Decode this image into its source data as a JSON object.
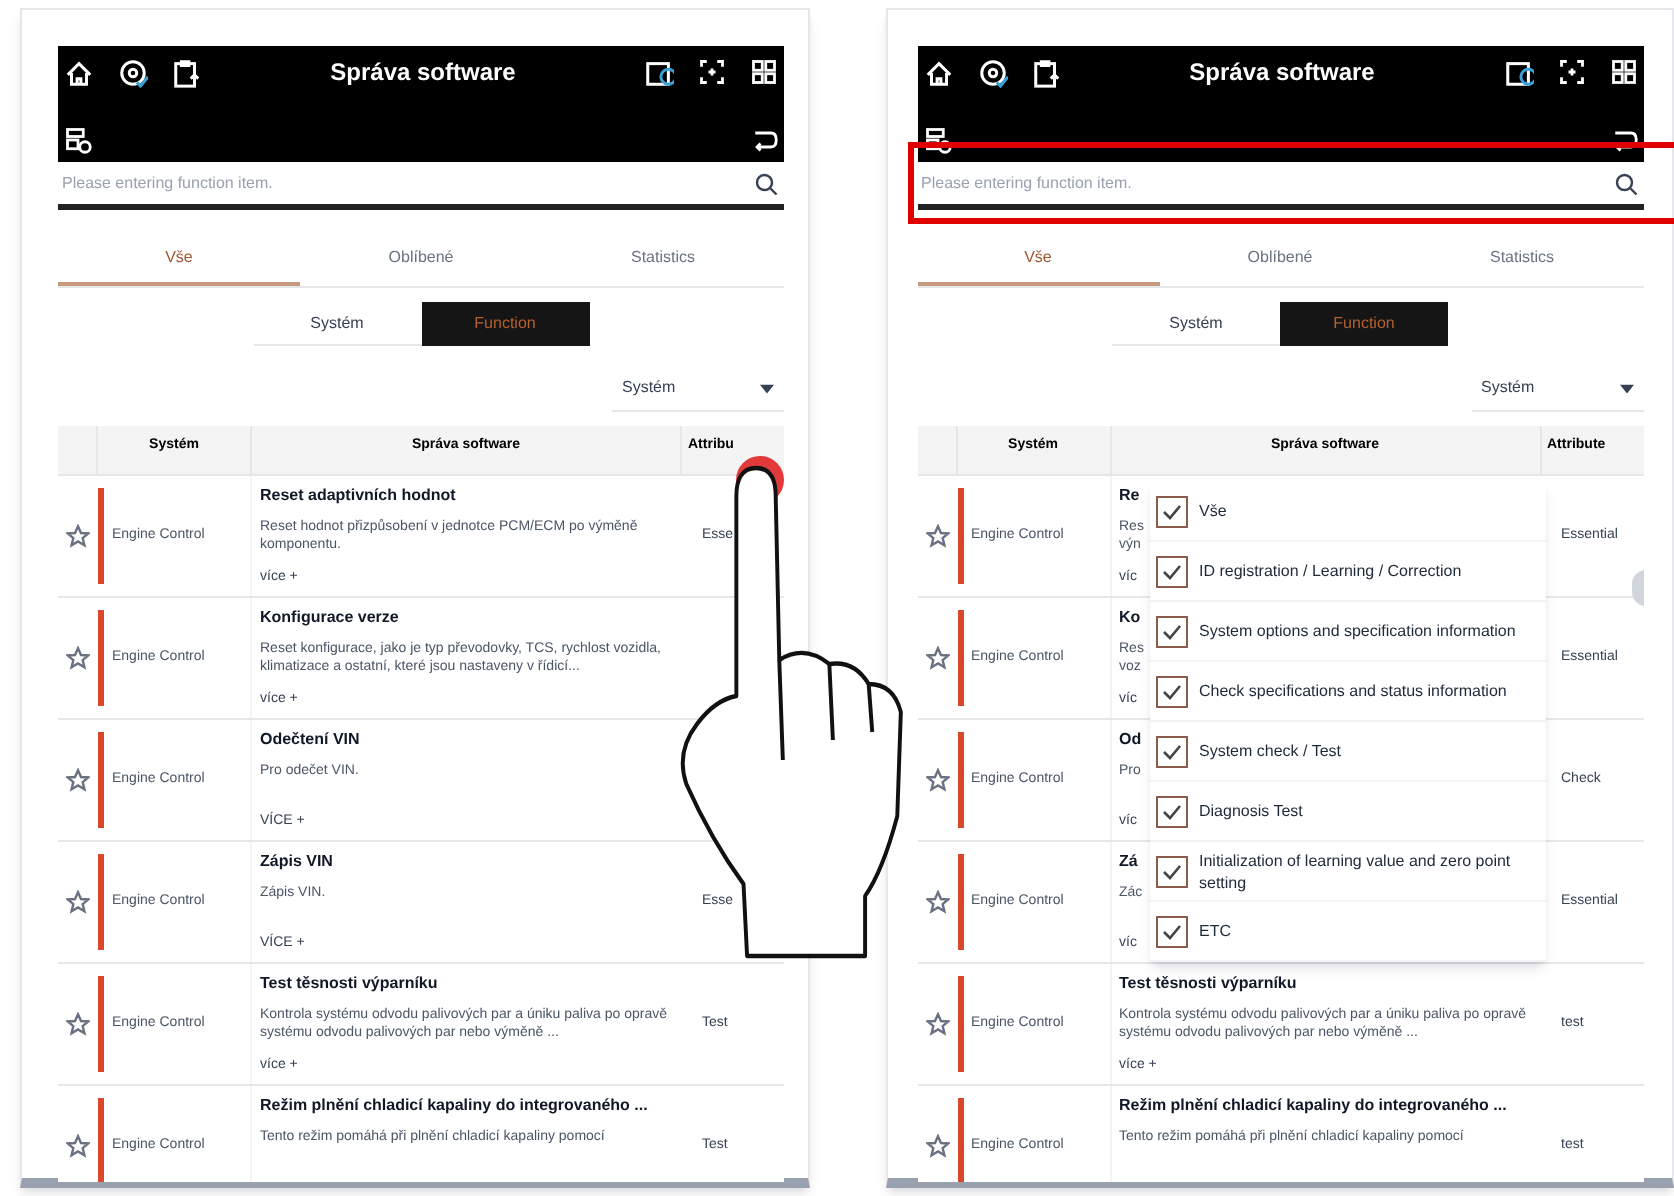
{
  "panels": [
    {
      "annotation": {
        "kind": "tap_hand"
      },
      "header": {
        "title": "Správa software"
      },
      "search": {
        "placeholder": "Please entering function item."
      },
      "tabs": [
        {
          "label": "Vše",
          "selected": true
        },
        {
          "label": "Oblíbené",
          "selected": false
        },
        {
          "label": "Statistics",
          "selected": false
        }
      ],
      "segments": [
        {
          "label": "Systém",
          "selected": false
        },
        {
          "label": "Function",
          "selected": true
        }
      ],
      "filter": {
        "value": "Systém"
      },
      "columns": [
        {
          "label": "Systém"
        },
        {
          "label": "Správa software"
        },
        {
          "label": "Attribu"
        }
      ],
      "rows": [
        {
          "favorite": false,
          "system": "Engine Control",
          "title": "Reset adaptivních hodnot",
          "description": "Reset hodnot přizpůsobení v jednotce PCM/ECM po výměně komponentu.",
          "more": "více +",
          "attribute": "Esse"
        },
        {
          "favorite": false,
          "system": "Engine Control",
          "title": "Konfigurace verze",
          "description": "Reset konfigurace, jako je typ převodovky, TCS, rychlost vozidla, klimatizace a ostatní, které jsou nastaveny v řídicí...",
          "more": "více +"
        },
        {
          "favorite": false,
          "system": "Engine Control",
          "title": "Odečtení VIN",
          "description": "Pro odečet VIN.",
          "more": "VÍCE +"
        },
        {
          "favorite": false,
          "system": "Engine Control",
          "title": "Zápis VIN",
          "description": "Zápis VIN.",
          "more": "VÍCE +",
          "attribute": "Esse"
        },
        {
          "favorite": false,
          "system": "Engine Control",
          "title": "Test těsnosti výparníku",
          "description": "Kontrola systému odvodu palivových par a úniku paliva po opravě systému odvodu palivových par nebo výměně ...",
          "more": "více +",
          "attribute": "Test"
        },
        {
          "favorite": false,
          "system": "Engine Control",
          "title": "Režim plnění chladicí kapaliny do integrovaného ...",
          "description": "Tento režim pomáhá při plnění chladicí kapaliny pomocí",
          "attribute": "Test"
        }
      ]
    },
    {
      "annotation": {
        "kind": "search_highlight"
      },
      "header": {
        "title": "Správa software"
      },
      "search": {
        "placeholder": "Please entering function item."
      },
      "tabs": [
        {
          "label": "Vše",
          "selected": true
        },
        {
          "label": "Oblíbené",
          "selected": false
        },
        {
          "label": "Statistics",
          "selected": false
        }
      ],
      "segments": [
        {
          "label": "Systém",
          "selected": false
        },
        {
          "label": "Function",
          "selected": true
        }
      ],
      "filter": {
        "value": "Systém"
      },
      "columns": [
        {
          "label": "Systém"
        },
        {
          "label": "Správa software"
        },
        {
          "label": "Attribute"
        }
      ],
      "rows": [
        {
          "favorite": false,
          "system": "Engine Control",
          "title": "Re",
          "description": "Res výn",
          "more": "víc",
          "attribute": "Essential"
        },
        {
          "favorite": false,
          "system": "Engine Control",
          "title": "Ko",
          "description": "Res voz",
          "more": "víc",
          "attribute": "Essential"
        },
        {
          "favorite": false,
          "system": "Engine Control",
          "title": "Od",
          "description": "Pro",
          "more": "víc",
          "attribute": "Check"
        },
        {
          "favorite": false,
          "system": "Engine Control",
          "title": "Zá",
          "description": "Zác",
          "more": "víc",
          "attribute": "Essential"
        },
        {
          "favorite": false,
          "system": "Engine Control",
          "title": "Test těsnosti výparníku",
          "description": "Kontrola systému odvodu palivových par a úniku paliva po opravě systému odvodu palivových par nebo výměně ...",
          "more": "více +",
          "attribute": "test"
        },
        {
          "favorite": false,
          "system": "Engine Control",
          "title": "Režim plnění chladicí kapaliny do integrovaného ...",
          "description": "Tento režim pomáhá při plnění chladicí kapaliny pomocí",
          "attribute": "test"
        }
      ],
      "filter_menu": {
        "items": [
          {
            "label": "Vše",
            "checked": true
          },
          {
            "label": "ID registration / Learning / Correction",
            "checked": true
          },
          {
            "label": "System options and specification information",
            "checked": true
          },
          {
            "label": "Check specifications and status information",
            "checked": true
          },
          {
            "label": "System check / Test",
            "checked": true
          },
          {
            "label": "Diagnosis Test",
            "checked": true
          },
          {
            "label": "Initialization of learning value and zero point setting",
            "checked": true
          },
          {
            "label": "ETC",
            "checked": true
          }
        ]
      }
    }
  ]
}
